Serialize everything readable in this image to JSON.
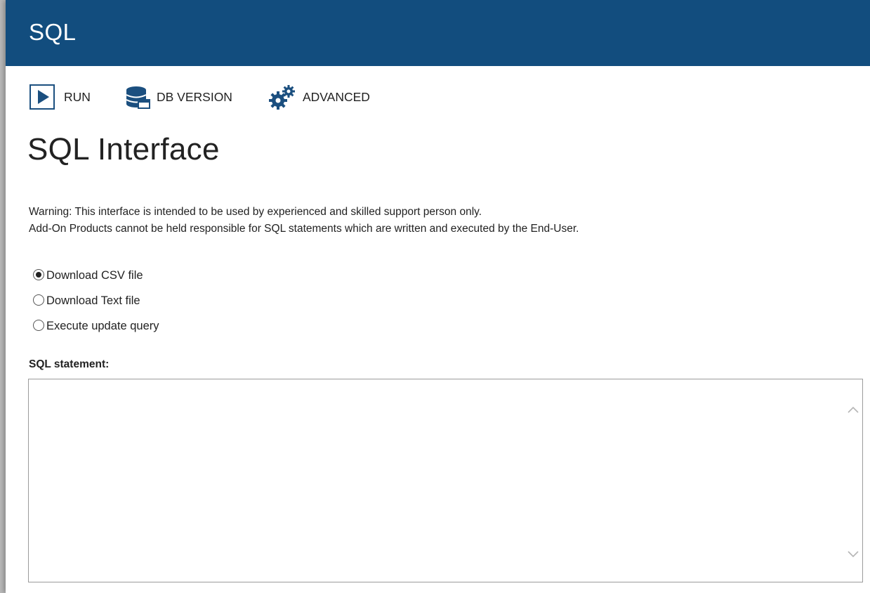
{
  "app": {
    "title": "SQL"
  },
  "toolbar": {
    "run_label": "RUN",
    "db_version_label": "DB VERSION",
    "advanced_label": "ADVANCED"
  },
  "page": {
    "title": "SQL Interface",
    "warning_line1": "Warning: This interface is intended to be used by experienced and skilled support person only.",
    "warning_line2": "Add-On Products cannot be held responsible for SQL statements which are written and executed by the End-User."
  },
  "output_options": {
    "selected": "Download CSV file",
    "options": [
      {
        "label": "Download CSV file",
        "checked": true
      },
      {
        "label": "Download Text file",
        "checked": false
      },
      {
        "label": "Execute update query",
        "checked": false
      }
    ]
  },
  "sql_field": {
    "label": "SQL statement:",
    "value": ""
  },
  "icons": {
    "run": "play-icon",
    "db_version": "database-icon",
    "advanced": "gears-icon",
    "scroll_up": "chevron-up-icon",
    "scroll_down": "chevron-down-icon"
  },
  "colors": {
    "header_bg": "#124d7e",
    "icon_blue": "#1b4f7f",
    "text": "#222222"
  }
}
